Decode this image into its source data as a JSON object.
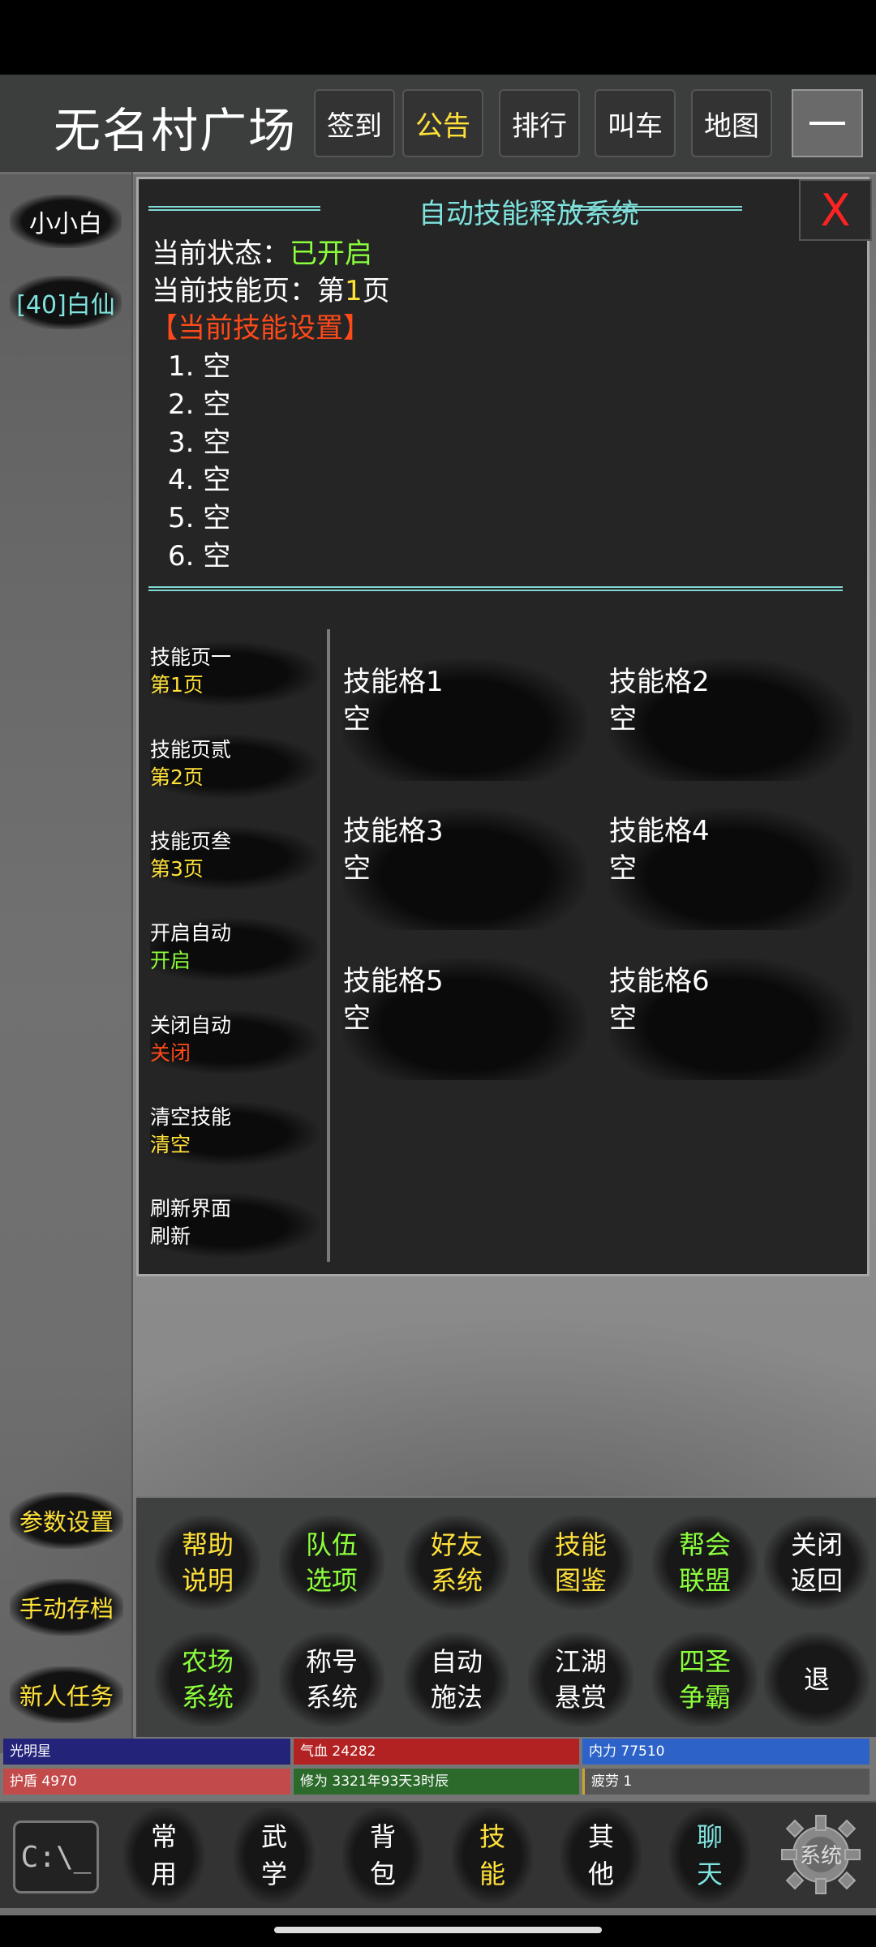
{
  "header": {
    "title": "无名村广场",
    "buttons": [
      {
        "label": "签到",
        "color": "#ffffff"
      },
      {
        "label": "公告",
        "color": "#ffe13a"
      },
      {
        "label": "排行",
        "color": "#ffffff"
      },
      {
        "label": "叫车",
        "color": "#ffffff"
      },
      {
        "label": "地图",
        "color": "#ffffff"
      }
    ],
    "minimize_icon": "minus-icon"
  },
  "left_panel": {
    "name": "小小白",
    "target": "[40]白仙"
  },
  "panel": {
    "title": "自动技能释放系统",
    "close_label": "X",
    "status_label": "当前状态：",
    "status_value": "已开启",
    "page_label": "当前技能页：第",
    "page_number": "1",
    "page_suffix": "页",
    "settings_header": "【当前技能设置】",
    "skill_list": [
      "1. 空",
      "2. 空",
      "3. 空",
      "4. 空",
      "5. 空",
      "6. 空"
    ],
    "menu": [
      {
        "title": "技能页一",
        "action": "第1页",
        "color": "#ffe13a"
      },
      {
        "title": "技能页贰",
        "action": "第2页",
        "color": "#ffe13a"
      },
      {
        "title": "技能页叁",
        "action": "第3页",
        "color": "#ffe13a"
      },
      {
        "title": "开启自动",
        "action": "开启",
        "color": "#8cff3c"
      },
      {
        "title": "关闭自动",
        "action": "关闭",
        "color": "#ff4a1a"
      },
      {
        "title": "清空技能",
        "action": "清空",
        "color": "#ffe13a"
      },
      {
        "title": "刷新界面",
        "action": "刷新",
        "color": "#ffffff"
      }
    ],
    "slots": [
      {
        "name": "技能格1",
        "value": "空"
      },
      {
        "name": "技能格2",
        "value": "空"
      },
      {
        "name": "技能格3",
        "value": "空"
      },
      {
        "name": "技能格4",
        "value": "空"
      },
      {
        "name": "技能格5",
        "value": "空"
      },
      {
        "name": "技能格6",
        "value": "空"
      }
    ]
  },
  "side_buttons": [
    "参数设置",
    "手动存档",
    "新人任务"
  ],
  "quick_menu": [
    {
      "l1": "帮助",
      "l2": "说明",
      "color": "#ffe13a"
    },
    {
      "l1": "队伍",
      "l2": "选项",
      "color": "#8cff3c"
    },
    {
      "l1": "好友",
      "l2": "系统",
      "color": "#ffe13a"
    },
    {
      "l1": "技能",
      "l2": "图鉴",
      "color": "#ffe13a"
    },
    {
      "l1": "帮会",
      "l2": "联盟",
      "color": "#8cff3c"
    },
    {
      "l1": "关闭",
      "l2": "返回",
      "color": "#ffffff"
    },
    {
      "l1": "农场",
      "l2": "系统",
      "color": "#8cff3c"
    },
    {
      "l1": "称号",
      "l2": "系统",
      "color": "#ffffff"
    },
    {
      "l1": "自动",
      "l2": "施法",
      "color": "#ffffff"
    },
    {
      "l1": "江湖",
      "l2": "悬赏",
      "color": "#ffffff"
    },
    {
      "l1": "四圣",
      "l2": "争霸",
      "color": "#8cff3c"
    },
    {
      "l1": "退",
      "l2": "",
      "color": "#ffffff"
    }
  ],
  "stats": {
    "name": "光明星",
    "hp": "气血 24282",
    "mp": "内力 77510",
    "shield": "护盾 4970",
    "cultivation": "修为 3321年93天3时辰",
    "fatigue": "疲劳 1"
  },
  "bottom_nav": [
    {
      "l1": "常",
      "l2": "用",
      "color": "#ffffff"
    },
    {
      "l1": "武",
      "l2": "学",
      "color": "#ffffff"
    },
    {
      "l1": "背",
      "l2": "包",
      "color": "#ffffff"
    },
    {
      "l1": "技",
      "l2": "能",
      "color": "#ffe13a"
    },
    {
      "l1": "其",
      "l2": "他",
      "color": "#ffffff"
    },
    {
      "l1": "聊",
      "l2": "天",
      "color": "#7fe3de"
    }
  ],
  "console_icon_text": "C:\\_",
  "gear_icon_text": "系统"
}
